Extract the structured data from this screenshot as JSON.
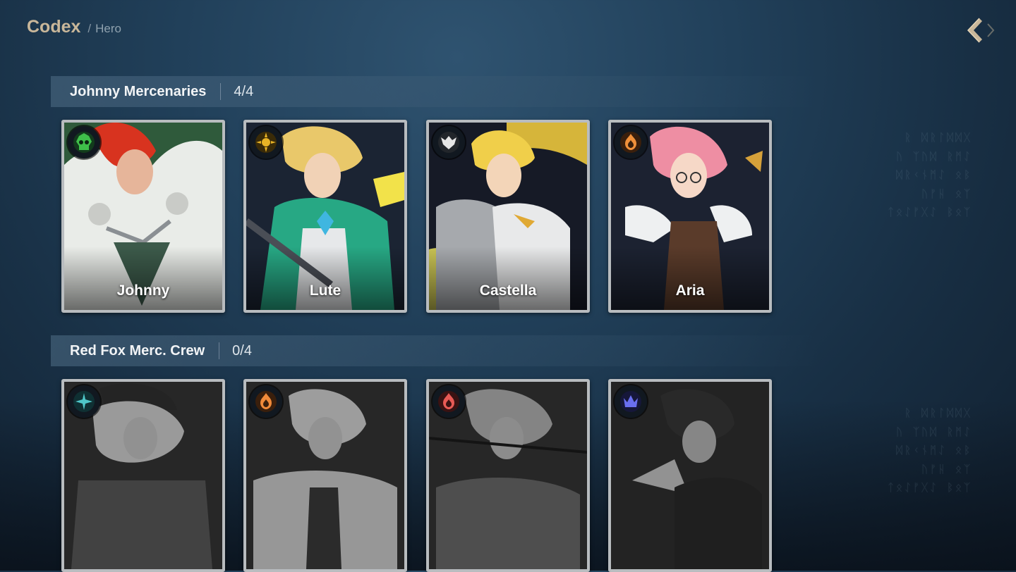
{
  "header": {
    "title": "Codex",
    "separator": "/",
    "crumb": "Hero"
  },
  "colors": {
    "title_gold": "#c9b79a",
    "frame_silver": "#b8bcbf"
  },
  "groups": [
    {
      "name": "Johnny Mercenaries",
      "count": "4/4",
      "heroes": [
        {
          "name": "Johnny",
          "icon": "skull-class-icon",
          "icon_color": "#3fbf4a",
          "unlocked": true
        },
        {
          "name": "Lute",
          "icon": "sun-class-icon",
          "icon_color": "#e8b326",
          "unlocked": true
        },
        {
          "name": "Castella",
          "icon": "wing-class-icon",
          "icon_color": "#e6e6e6",
          "unlocked": true
        },
        {
          "name": "Aria",
          "icon": "flame-class-icon",
          "icon_color": "#f0903a",
          "unlocked": true
        }
      ]
    },
    {
      "name": "Red Fox Merc. Crew",
      "count": "0/4",
      "heroes": [
        {
          "name": "",
          "icon": "frost-class-icon",
          "icon_color": "#4fc7c9",
          "unlocked": false
        },
        {
          "name": "",
          "icon": "flame-class-icon",
          "icon_color": "#f08a3a",
          "unlocked": false
        },
        {
          "name": "",
          "icon": "flame-class-icon",
          "icon_color": "#e85a55",
          "unlocked": false
        },
        {
          "name": "",
          "icon": "crown-class-icon",
          "icon_color": "#6a6ff0",
          "unlocked": false
        }
      ]
    }
  ]
}
